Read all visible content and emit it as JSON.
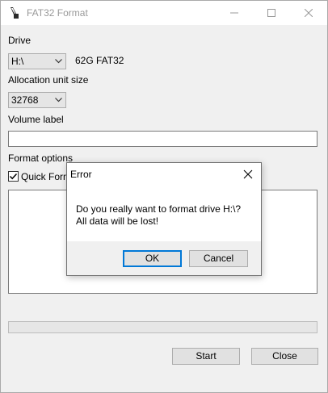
{
  "window": {
    "title": "FAT32 Format",
    "icons": {
      "app": "brush-icon",
      "minimize": "minimize-icon",
      "maximize": "maximize-icon",
      "close": "close-icon"
    }
  },
  "form": {
    "drive_label": "Drive",
    "drive_value": "H:\\",
    "drive_info": "62G FAT32",
    "allocation_label": "Allocation unit size",
    "allocation_value": "32768",
    "volume_label": "Volume label",
    "volume_value": "",
    "format_options_label": "Format options",
    "quick_format_label": "Quick Format",
    "quick_format_checked": true
  },
  "buttons": {
    "start": "Start",
    "close": "Close"
  },
  "progress": {
    "value": 0
  },
  "dialog": {
    "title": "Error",
    "message_line1": "Do you really want to format drive H:\\?",
    "message_line2": "All data will be lost!",
    "ok": "OK",
    "cancel": "Cancel"
  }
}
